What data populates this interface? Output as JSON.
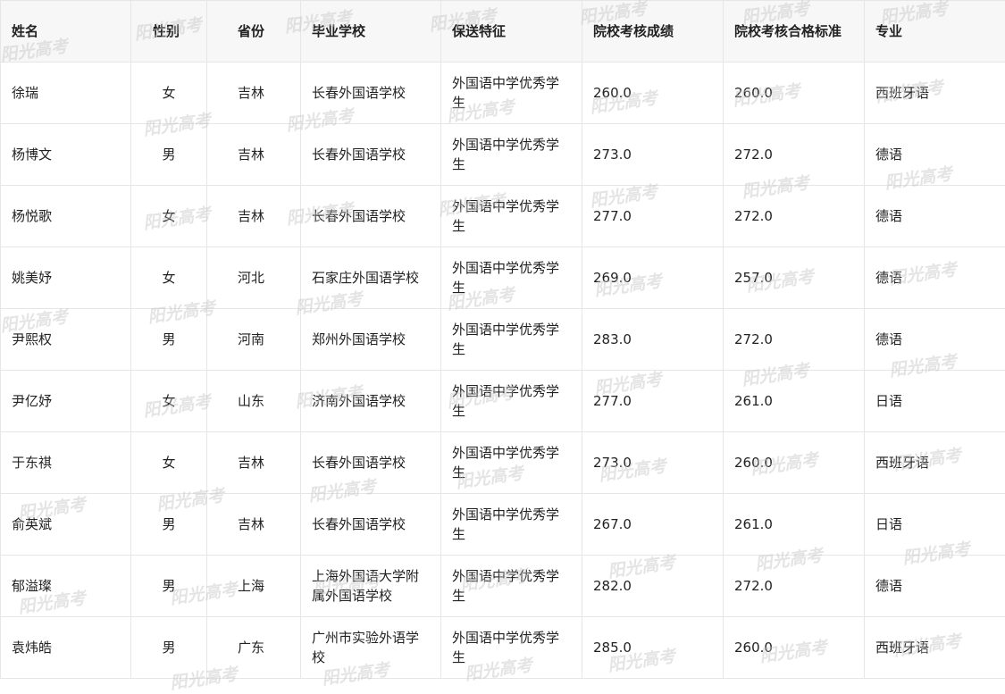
{
  "watermark": "阳光高考",
  "table": {
    "headers": [
      "姓名",
      "性别",
      "省份",
      "毕业学校",
      "保送特征",
      "院校考核成绩",
      "院校考核合格标准",
      "专业"
    ],
    "rows": [
      [
        "徐瑞",
        "女",
        "吉林",
        "长春外国语学校",
        "外国语中学优秀学生",
        "260.0",
        "260.0",
        "西班牙语"
      ],
      [
        "杨博文",
        "男",
        "吉林",
        "长春外国语学校",
        "外国语中学优秀学生",
        "273.0",
        "272.0",
        "德语"
      ],
      [
        "杨悦歌",
        "女",
        "吉林",
        "长春外国语学校",
        "外国语中学优秀学生",
        "277.0",
        "272.0",
        "德语"
      ],
      [
        "姚美妤",
        "女",
        "河北",
        "石家庄外国语学校",
        "外国语中学优秀学生",
        "269.0",
        "257.0",
        "德语"
      ],
      [
        "尹熙权",
        "男",
        "河南",
        "郑州外国语学校",
        "外国语中学优秀学生",
        "283.0",
        "272.0",
        "德语"
      ],
      [
        "尹亿妤",
        "女",
        "山东",
        "济南外国语学校",
        "外国语中学优秀学生",
        "277.0",
        "261.0",
        "日语"
      ],
      [
        "于东祺",
        "女",
        "吉林",
        "长春外国语学校",
        "外国语中学优秀学生",
        "273.0",
        "260.0",
        "西班牙语"
      ],
      [
        "俞英斌",
        "男",
        "吉林",
        "长春外国语学校",
        "外国语中学优秀学生",
        "267.0",
        "261.0",
        "日语"
      ],
      [
        "郁溢璨",
        "男",
        "上海",
        "上海外国语大学附属外国语学校",
        "外国语中学优秀学生",
        "282.0",
        "272.0",
        "德语"
      ],
      [
        "袁炜皓",
        "男",
        "广东",
        "广州市实验外语学校",
        "外国语中学优秀学生",
        "285.0",
        "260.0",
        "西班牙语"
      ]
    ]
  }
}
